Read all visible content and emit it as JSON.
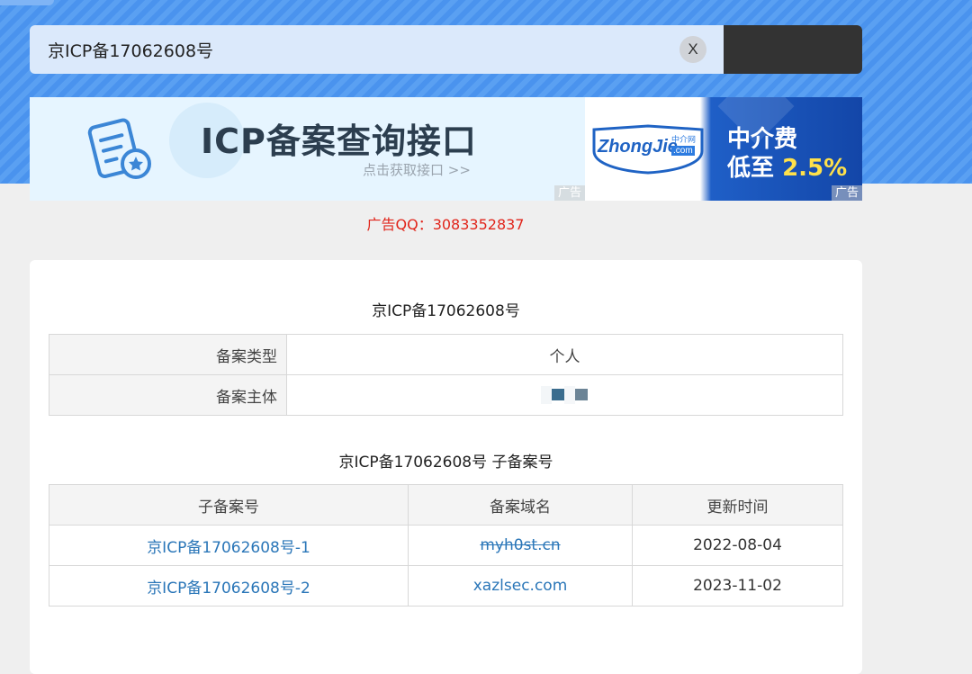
{
  "search": {
    "value": "京ICP备17062608号",
    "clear_label": "X"
  },
  "banner_left": {
    "title": "ICP备案查询接口",
    "subtitle": "点击获取接口 >>",
    "ad_tag": "广告"
  },
  "banner_right": {
    "logo_text": "ZhongJie",
    "logo_small": "中介网",
    "logo_domain": ".com",
    "promo_line1": "中介费",
    "promo_line2_prefix": "低至 ",
    "promo_line2_highlight": "2.5%",
    "ad_tag": "广告"
  },
  "ad_qq": "广告QQ：3083352837",
  "record": {
    "title": "京ICP备17062608号",
    "rows": [
      {
        "key": "备案类型",
        "value": "个人"
      },
      {
        "key": "备案主体",
        "value": ""
      }
    ]
  },
  "sub_records": {
    "title": "京ICP备17062608号 子备案号",
    "headers": [
      "子备案号",
      "备案域名",
      "更新时间"
    ],
    "rows": [
      {
        "number": "京ICP备17062608号-1",
        "domain": "myh0st.cn",
        "updated": "2022-08-04"
      },
      {
        "number": "京ICP备17062608号-2",
        "domain": "xazlsec.com",
        "updated": "2023-11-02"
      }
    ]
  },
  "colors": {
    "accent_blue": "#4a93ee",
    "link": "#2a76b8",
    "ad_red": "#e1251b"
  }
}
